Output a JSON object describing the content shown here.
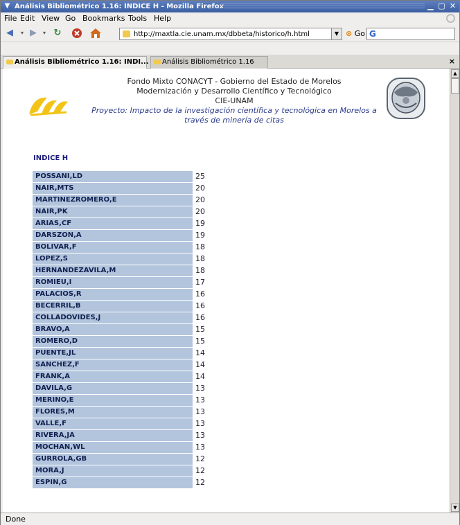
{
  "window": {
    "title": "Análisis Bibliométrico 1.16: INDICE H - Mozilla Firefox"
  },
  "menubar": [
    "File",
    "Edit",
    "View",
    "Go",
    "Bookmarks",
    "Tools",
    "Help"
  ],
  "navbar": {
    "url": "http://maxtla.cie.unam.mx/dbbeta/historico/h.html",
    "go_label": "Go"
  },
  "tabs": [
    {
      "label": "Análisis Bibliométrico 1.16: INDI...",
      "active": true
    },
    {
      "label": "Análisis Bibliométrico 1.16",
      "active": false
    }
  ],
  "page": {
    "header_lines": [
      "Fondo Mixto CONACYT - Gobierno del Estado de Morelos",
      "Modernización y Desarrollo Científico y Tecnológico",
      "CIE-UNAM"
    ],
    "project_line": "Proyecto: Impacto de la investigación científica y tecnológica en Morelos a través de minería de citas",
    "section_title": "INDICE H",
    "rows": [
      {
        "name": "POSSANI,LD",
        "value": "25"
      },
      {
        "name": "NAIR,MTS",
        "value": "20"
      },
      {
        "name": "MARTINEZROMERO,E",
        "value": "20"
      },
      {
        "name": "NAIR,PK",
        "value": "20"
      },
      {
        "name": "ARIAS,CF",
        "value": "19"
      },
      {
        "name": "DARSZON,A",
        "value": "19"
      },
      {
        "name": "BOLIVAR,F",
        "value": "18"
      },
      {
        "name": "LOPEZ,S",
        "value": "18"
      },
      {
        "name": "HERNANDEZAVILA,M",
        "value": "18"
      },
      {
        "name": "ROMIEU,I",
        "value": "17"
      },
      {
        "name": "PALACIOS,R",
        "value": "16"
      },
      {
        "name": "BECERRIL,B",
        "value": "16"
      },
      {
        "name": "COLLADOVIDES,J",
        "value": "16"
      },
      {
        "name": "BRAVO,A",
        "value": "15"
      },
      {
        "name": "ROMERO,D",
        "value": "15"
      },
      {
        "name": "PUENTE,JL",
        "value": "14"
      },
      {
        "name": "SANCHEZ,F",
        "value": "14"
      },
      {
        "name": "FRANK,A",
        "value": "14"
      },
      {
        "name": "DAVILA,G",
        "value": "13"
      },
      {
        "name": "MERINO,E",
        "value": "13"
      },
      {
        "name": "FLORES,M",
        "value": "13"
      },
      {
        "name": "VALLE,F",
        "value": "13"
      },
      {
        "name": "RIVERA,JA",
        "value": "13"
      },
      {
        "name": "MOCHAN,WL",
        "value": "13"
      },
      {
        "name": "GURROLA,GB",
        "value": "12"
      },
      {
        "name": "MORA,J",
        "value": "12"
      },
      {
        "name": "ESPIN,G",
        "value": "12"
      }
    ]
  },
  "statusbar": {
    "status": "Done"
  },
  "icons": {
    "window_menu": "chevron-down-icon",
    "minimize": "minimize-icon",
    "maximize": "maximize-icon",
    "close": "close-icon",
    "back": "back-arrow-icon",
    "forward": "forward-arrow-icon",
    "reload": "reload-icon",
    "stop": "stop-icon",
    "home": "home-icon",
    "search_engine": "google-icon"
  },
  "colors": {
    "titlebar": "#3b5ea3",
    "row_bg": "#b3c5dd",
    "section_title": "#1a1a7a",
    "project_text": "#2a3a8c",
    "logo_yellow": "#f2c418"
  }
}
